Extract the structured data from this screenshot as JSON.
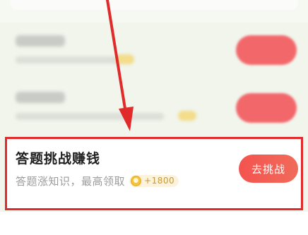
{
  "task": {
    "title": "答题挑战赚钱",
    "subtitle": "答题涨知识，最高领取",
    "reward": "+1800",
    "button_label": "去挑战"
  },
  "colors": {
    "annotation_red": "#e12a2a",
    "button_red": "#f4534f",
    "coin_gold": "#f5c33b",
    "page_bg": "#f1f5ec"
  },
  "icons": {
    "coin": "gold-coin-icon",
    "annotation": "red-arrow-icon"
  }
}
